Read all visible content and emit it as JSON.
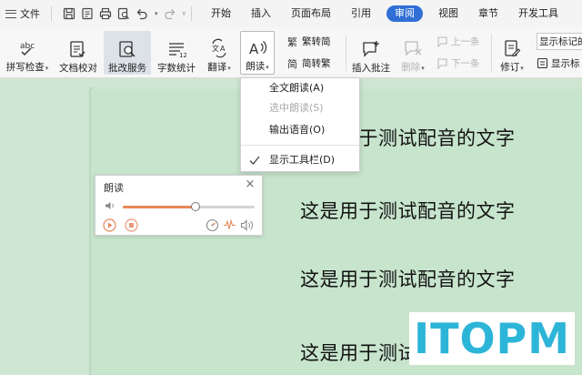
{
  "menubar": {
    "file_label": "文件",
    "tabs": [
      "开始",
      "插入",
      "页面布局",
      "引用",
      "审阅",
      "视图",
      "章节",
      "开发工具"
    ],
    "active_tab": "审阅"
  },
  "ribbon": {
    "spell_check": "拼写检查",
    "doc_compare": "文档校对",
    "review_service": "批改服务",
    "word_count": "字数统计",
    "translate": "翻译",
    "read_aloud": "朗读",
    "trad_to_simp": "繁转简",
    "simp_to_trad": "简转繁",
    "insert_comment": "插入批注",
    "delete": "删除",
    "prev_item": "上一条",
    "next_item": "下一条",
    "revisions": "修订",
    "show_markup": "显示标记的",
    "reviewer_label": "显示标"
  },
  "dropdown": {
    "items": [
      {
        "label": "全文朗读(A)",
        "enabled": true
      },
      {
        "label": "选中朗读(S)",
        "enabled": false
      },
      {
        "label": "输出语音(O)",
        "enabled": true
      },
      {
        "label": "显示工具栏(D)",
        "enabled": true,
        "checked": true
      }
    ]
  },
  "read_panel": {
    "title": "朗读",
    "close_glyph": "×",
    "progress": 0.55
  },
  "document": {
    "lines": [
      "这是用于测试配音的文字",
      "这是用于测试配音的文字",
      "这是用于测试配音的文字",
      "这是用于测试配音的文字"
    ]
  },
  "watermark": "ITOPM",
  "colors": {
    "accent": "#2f6fd6",
    "slider_fill": "#e8875a",
    "page_bg": "#c7e4cc",
    "watermark": "#2db5d8"
  }
}
